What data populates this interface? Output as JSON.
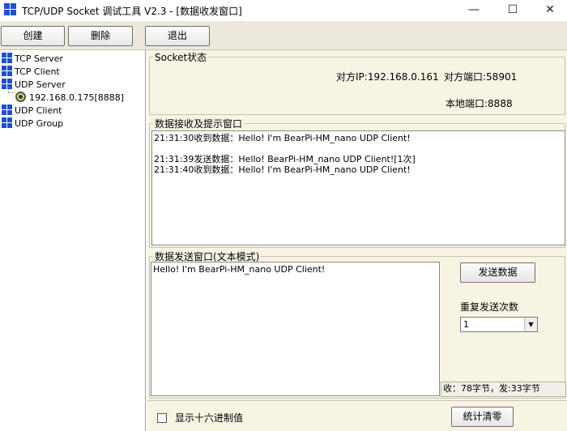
{
  "window": {
    "title": "TCP/UDP Socket 调试工具 V2.3 - [数据收发窗口]",
    "minimize_glyph": "—",
    "maximize_glyph": "☐",
    "close_glyph": "✕"
  },
  "toolbar": {
    "create_label": "创建",
    "delete_label": "删除",
    "exit_label": "退出"
  },
  "tree": {
    "items": [
      {
        "label": "TCP Server"
      },
      {
        "label": "TCP Client"
      },
      {
        "label": "UDP Server"
      },
      {
        "label": "192.168.0.175[8888]"
      },
      {
        "label": "UDP Client"
      },
      {
        "label": "UDP Group"
      }
    ]
  },
  "socket_status": {
    "legend": "Socket状态",
    "remote_ip": "对方IP:192.168.0.161",
    "remote_port": "对方端口:58901",
    "local_port": "本地端口:8888"
  },
  "receive": {
    "legend": "数据接收及提示窗口",
    "lines": [
      "21:31:30收到数据：Hello! I'm BearPi-HM_nano UDP Client!",
      "",
      "21:31:39发送数据：Hello! BearPi-HM_nano UDP Client![1次]",
      "21:31:40收到数据：Hello! I'm BearPi-HM_nano UDP Client!"
    ]
  },
  "send": {
    "legend": "数据发送窗口(文本模式)",
    "text": "Hello! I'm BearPi-HM_nano UDP Client!",
    "send_button": "发送数据",
    "repeat_label": "重复发送次数",
    "repeat_value": "1",
    "stats": "收：78字节，发:33字节"
  },
  "bottom": {
    "hex_label": "显示十六进制值",
    "clear_stats_button": "统计清零"
  }
}
